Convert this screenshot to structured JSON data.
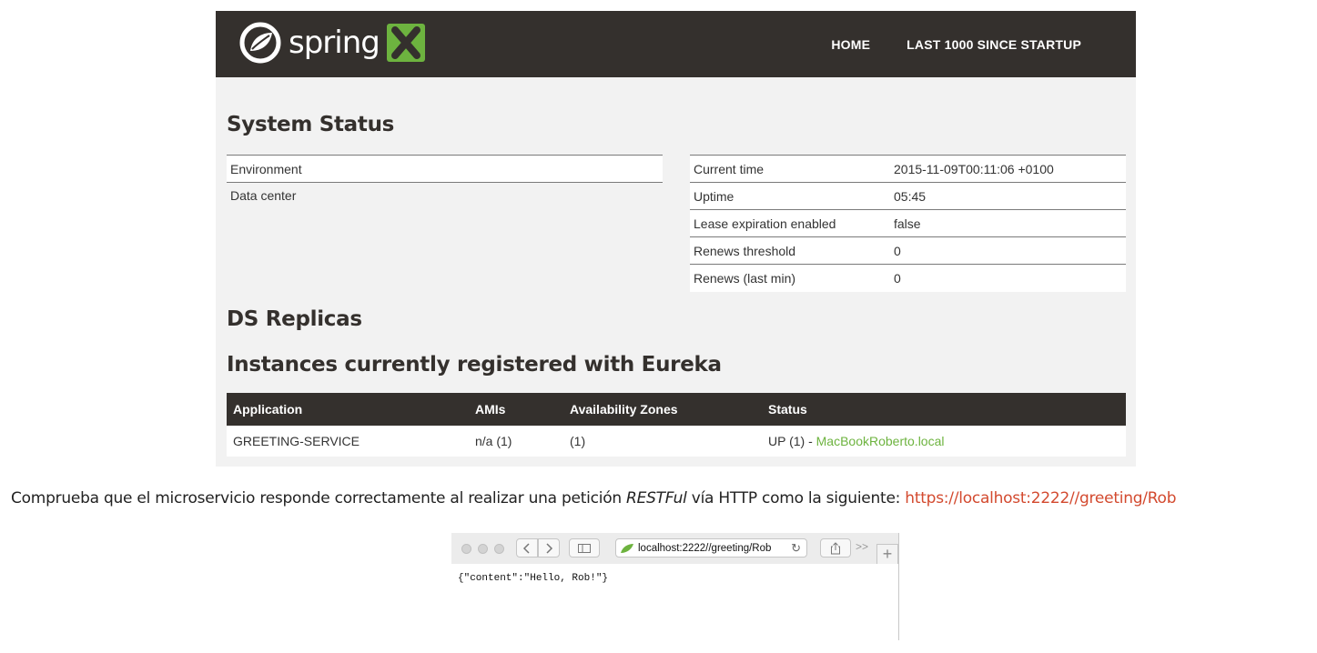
{
  "eureka": {
    "logo_text": "spring",
    "nav": [
      "HOME",
      "LAST 1000 SINCE STARTUP"
    ],
    "system_status_title": "System Status",
    "left_table": [
      {
        "key": "Environment",
        "value": ""
      },
      {
        "key": "Data center",
        "value": ""
      }
    ],
    "right_table": [
      {
        "key": "Current time",
        "value": "2015-11-09T00:11:06 +0100"
      },
      {
        "key": "Uptime",
        "value": "05:45"
      },
      {
        "key": "Lease expiration enabled",
        "value": "false"
      },
      {
        "key": "Renews threshold",
        "value": "0"
      },
      {
        "key": "Renews (last min)",
        "value": "0"
      }
    ],
    "ds_replicas_title": "DS Replicas",
    "instances_title": "Instances currently registered with Eureka",
    "instances_table": {
      "headers": [
        "Application",
        "AMIs",
        "Availability Zones",
        "Status"
      ],
      "rows": [
        {
          "application": "GREETING-SERVICE",
          "amis": "n/a (1)",
          "zones": "(1)",
          "status_prefix": "UP (1) - ",
          "status_link": "MacBookRoberto.local"
        }
      ]
    },
    "colors": {
      "navbar": "#34302d",
      "spring_green": "#6db33f",
      "panel_bg": "#f2f2f2"
    }
  },
  "caption": {
    "text_before": "Comprueba que el microservicio responde correctamente al realizar una petición ",
    "italic": "RESTFul",
    "text_after": " vía HTTP como la siguiente: ",
    "url": "https://localhost:2222//greeting/Rob",
    "url_color": "#d34a2f"
  },
  "browser": {
    "address": "localhost:2222//greeting/Rob",
    "body": "{\"content\":\"Hello, Rob!\"}",
    "icons": [
      "traffic-light-dots",
      "back-icon",
      "forward-icon",
      "sidebar-icon",
      "spring-leaf-icon",
      "reload-icon",
      "share-icon",
      "overflow-chevron-icon",
      "new-tab-plus-icon"
    ]
  }
}
